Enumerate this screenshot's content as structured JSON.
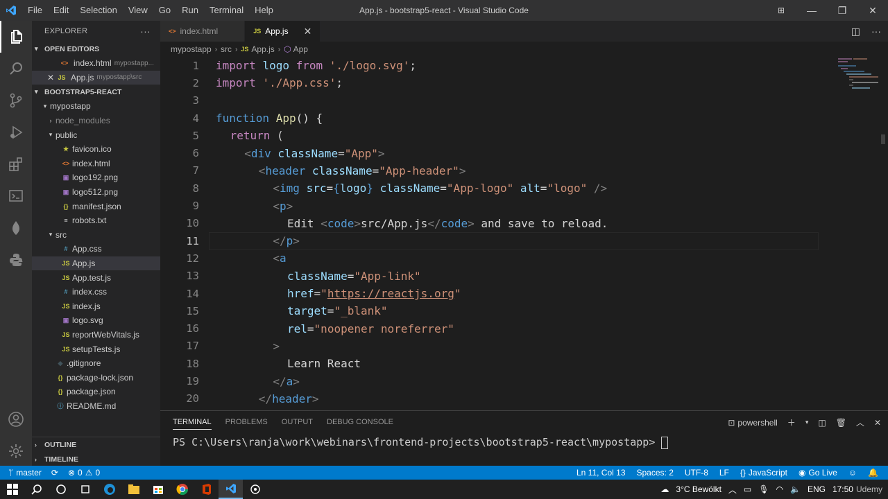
{
  "window": {
    "title": "App.js - bootstrap5-react - Visual Studio Code",
    "menu": [
      "File",
      "Edit",
      "Selection",
      "View",
      "Go",
      "Run",
      "Terminal",
      "Help"
    ]
  },
  "activity_icons": [
    "explorer-icon",
    "search-icon",
    "source-control-icon",
    "run-debug-icon",
    "extensions-icon",
    "remote-explorer-icon",
    "mongodb-icon",
    "python-icon",
    "accounts-icon",
    "manage-icon"
  ],
  "sidebar": {
    "title": "EXPLORER",
    "open_editors": {
      "title": "OPEN EDITORS",
      "items": [
        {
          "icon": "<>",
          "name": "index.html",
          "path": "mypostapp..."
        },
        {
          "icon": "JS",
          "name": "App.js",
          "path": "mypostapp\\src"
        }
      ]
    },
    "project": {
      "title": "BOOTSTRAP5-REACT",
      "tree": [
        {
          "label": "mypostapp",
          "type": "folder",
          "level": 1
        },
        {
          "label": "node_modules",
          "type": "folder-closed",
          "level": 2
        },
        {
          "label": "public",
          "type": "folder",
          "level": 2
        },
        {
          "label": "favicon.ico",
          "type": "file",
          "icon": "★",
          "level": 3
        },
        {
          "label": "index.html",
          "type": "file",
          "icon": "<>",
          "level": 3
        },
        {
          "label": "logo192.png",
          "type": "file",
          "icon": "▣",
          "level": 3
        },
        {
          "label": "logo512.png",
          "type": "file",
          "icon": "▣",
          "level": 3
        },
        {
          "label": "manifest.json",
          "type": "file",
          "icon": "{}",
          "level": 3
        },
        {
          "label": "robots.txt",
          "type": "file",
          "icon": "≡",
          "level": 3
        },
        {
          "label": "src",
          "type": "folder",
          "level": 2
        },
        {
          "label": "App.css",
          "type": "file",
          "icon": "#",
          "level": 3
        },
        {
          "label": "App.js",
          "type": "file",
          "icon": "JS",
          "level": 3
        },
        {
          "label": "App.test.js",
          "type": "file",
          "icon": "JS",
          "level": 3
        },
        {
          "label": "index.css",
          "type": "file",
          "icon": "#",
          "level": 3
        },
        {
          "label": "index.js",
          "type": "file",
          "icon": "JS",
          "level": 3
        },
        {
          "label": "logo.svg",
          "type": "file",
          "icon": "▣",
          "level": 3
        },
        {
          "label": "reportWebVitals.js",
          "type": "file",
          "icon": "JS",
          "level": 3
        },
        {
          "label": "setupTests.js",
          "type": "file",
          "icon": "JS",
          "level": 3
        },
        {
          "label": ".gitignore",
          "type": "file",
          "icon": "◆",
          "level": 2
        },
        {
          "label": "package-lock.json",
          "type": "file",
          "icon": "{}",
          "level": 2
        },
        {
          "label": "package.json",
          "type": "file",
          "icon": "{}",
          "level": 2
        },
        {
          "label": "README.md",
          "type": "file",
          "icon": "ⓘ",
          "level": 2
        }
      ]
    },
    "outline": "OUTLINE",
    "timeline": "TIMELINE"
  },
  "tabs": [
    {
      "icon": "<>",
      "label": "index.html",
      "active": false
    },
    {
      "icon": "JS",
      "label": "App.js",
      "active": true
    }
  ],
  "breadcrumb": [
    "mypostapp",
    "src",
    "App.js",
    "App"
  ],
  "editor": {
    "current_line": 11,
    "lines": [
      {
        "n": "1"
      },
      {
        "n": "2"
      },
      {
        "n": "3"
      },
      {
        "n": "4"
      },
      {
        "n": "5"
      },
      {
        "n": "6"
      },
      {
        "n": "7"
      },
      {
        "n": "8"
      },
      {
        "n": "9"
      },
      {
        "n": "10"
      },
      {
        "n": "11"
      },
      {
        "n": "12"
      },
      {
        "n": "13"
      },
      {
        "n": "14"
      },
      {
        "n": "15"
      },
      {
        "n": "16"
      },
      {
        "n": "17"
      },
      {
        "n": "18"
      },
      {
        "n": "19"
      },
      {
        "n": "20"
      }
    ],
    "code": {
      "l1": [
        "import",
        "logo",
        "from",
        "'./logo.svg'",
        ";"
      ],
      "l2": [
        "import",
        "'./App.css'",
        ";"
      ],
      "l4": [
        "function",
        "App",
        "() {"
      ],
      "l5": [
        "return",
        "("
      ],
      "l6": [
        "<",
        "div",
        "className",
        "=",
        "\"App\"",
        ">"
      ],
      "l7": [
        "<",
        "header",
        "className",
        "=",
        "\"App-header\"",
        ">"
      ],
      "l8": [
        "<",
        "img",
        "src",
        "=",
        "{",
        "logo",
        "}",
        "className",
        "=",
        "\"App-logo\"",
        "alt",
        "=",
        "\"logo\"",
        "/>"
      ],
      "l9": [
        "<",
        "p",
        ">"
      ],
      "l10": [
        "Edit ",
        "<",
        "code",
        ">",
        "src/App.js",
        "</",
        "code",
        ">",
        " and save to reload."
      ],
      "l11": [
        "</",
        "p",
        ">"
      ],
      "l12": [
        "<",
        "a"
      ],
      "l13": [
        "className",
        "=",
        "\"App-link\""
      ],
      "l14": [
        "href",
        "=",
        "\"",
        "https://reactjs.org",
        "\""
      ],
      "l15": [
        "target",
        "=",
        "\"_blank\""
      ],
      "l16": [
        "rel",
        "=",
        "\"noopener noreferrer\""
      ],
      "l17": [
        ">"
      ],
      "l18": [
        "Learn React"
      ],
      "l19": [
        "</",
        "a",
        ">"
      ],
      "l20": [
        "</",
        "header",
        ">"
      ]
    }
  },
  "panel": {
    "tabs": [
      "TERMINAL",
      "PROBLEMS",
      "OUTPUT",
      "DEBUG CONSOLE"
    ],
    "active_tab": "TERMINAL",
    "shell": "powershell",
    "prompt": "PS C:\\Users\\ranja\\work\\webinars\\frontend-projects\\bootstrap5-react\\mypostapp> "
  },
  "statusbar": {
    "branch": "master",
    "errors": "0",
    "warnings": "0",
    "position": "Ln 11, Col 13",
    "spaces": "Spaces: 2",
    "encoding": "UTF-8",
    "eol": "LF",
    "language": "JavaScript",
    "golive": "Go Live"
  },
  "taskbar": {
    "weather": "3°C  Bewölkt",
    "lang": "ENG",
    "time": "17:50",
    "watermark": "Udemy"
  },
  "colors": {
    "accent": "#007acc",
    "activity_bar": "#333333",
    "sidebar": "#252526",
    "editor": "#1e1e1e"
  }
}
